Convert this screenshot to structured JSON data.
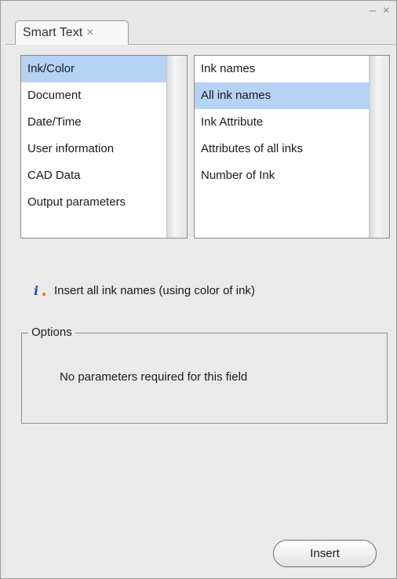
{
  "window": {
    "controls": [
      "–",
      "×"
    ]
  },
  "tab": {
    "label": "Smart Text",
    "close": "×"
  },
  "categories": {
    "items": [
      {
        "label": "Ink/Color",
        "selected": true
      },
      {
        "label": "Document",
        "selected": false
      },
      {
        "label": "Date/Time",
        "selected": false
      },
      {
        "label": "User information",
        "selected": false
      },
      {
        "label": "CAD Data",
        "selected": false
      },
      {
        "label": "Output parameters",
        "selected": false
      }
    ]
  },
  "fields": {
    "items": [
      {
        "label": "Ink names",
        "selected": false
      },
      {
        "label": "All ink names",
        "selected": true
      },
      {
        "label": "Ink Attribute",
        "selected": false
      },
      {
        "label": "Attributes of all inks",
        "selected": false
      },
      {
        "label": "Number of Ink",
        "selected": false
      }
    ]
  },
  "info": {
    "icon": "info-icon",
    "icon_glyph": "i",
    "text": "Insert all ink names (using color of ink)"
  },
  "options": {
    "legend": "Options",
    "message": "No parameters required for this field"
  },
  "actions": {
    "insert_label": "Insert"
  },
  "colors": {
    "selection": "#b6d2f4",
    "panel_background": "#eaeaea"
  }
}
